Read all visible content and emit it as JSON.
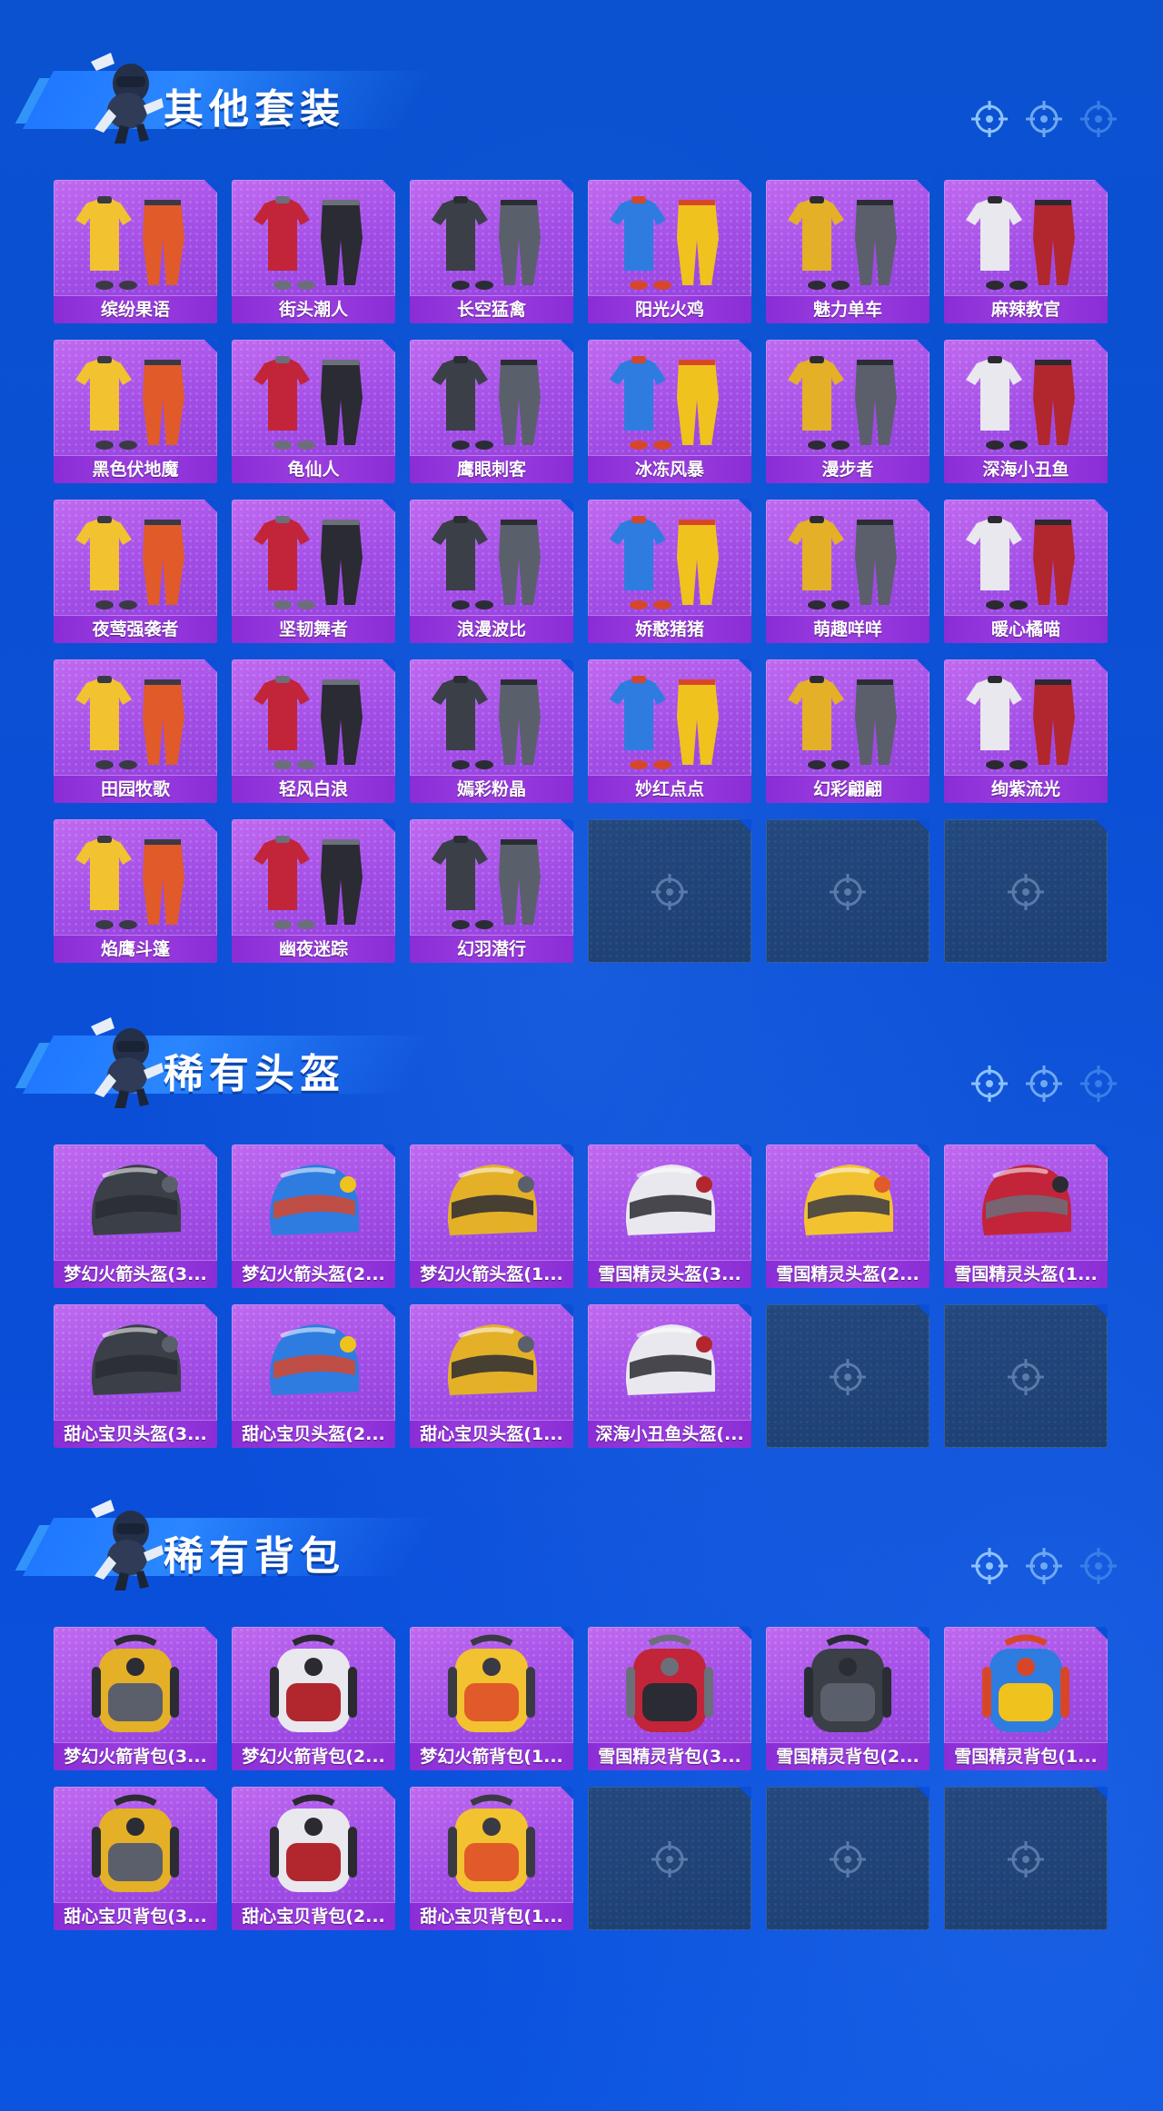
{
  "sections": [
    {
      "title": "其他套装",
      "items": [
        "缤纷果语",
        "街头潮人",
        "长空猛禽",
        "阳光火鸡",
        "魅力单车",
        "麻辣教官",
        "黑色伏地魔",
        "龟仙人",
        "鹰眼刺客",
        "冰冻风暴",
        "漫步者",
        "深海小丑鱼",
        "夜莺强袭者",
        "坚韧舞者",
        "浪漫波比",
        "娇憨猪猪",
        "萌趣咩咩",
        "暖心橘喵",
        "田园牧歌",
        "轻风白浪",
        "嫣彩粉晶",
        "妙红点点",
        "幻彩翩翩",
        "绚紫流光",
        "焰鹰斗篷",
        "幽夜迷踪",
        "幻羽潜行"
      ],
      "empty_slots": 3
    },
    {
      "title": "稀有头盔",
      "items": [
        "梦幻火箭头盔(3...",
        "梦幻火箭头盔(2...",
        "梦幻火箭头盔(1...",
        "雪国精灵头盔(3...",
        "雪国精灵头盔(2...",
        "雪国精灵头盔(1...",
        "甜心宝贝头盔(3...",
        "甜心宝贝头盔(2...",
        "甜心宝贝头盔(1...",
        "深海小丑鱼头盔(..."
      ],
      "empty_slots": 2
    },
    {
      "title": "稀有背包",
      "items": [
        "梦幻火箭背包(3...",
        "梦幻火箭背包(2...",
        "梦幻火箭背包(1...",
        "雪国精灵背包(3...",
        "雪国精灵背包(2...",
        "雪国精灵背包(1...",
        "甜心宝贝背包(3...",
        "甜心宝贝背包(2...",
        "甜心宝贝背包(1..."
      ],
      "empty_slots": 3
    }
  ],
  "icons": {
    "mascot": "parachute-mascot-icon",
    "crosshair": "crosshair-icon"
  },
  "colors": {
    "background": "#0b4fd6",
    "card": "#a24ee6",
    "label_bar": "#8a2dd6",
    "empty_slot": "#1f4376"
  }
}
